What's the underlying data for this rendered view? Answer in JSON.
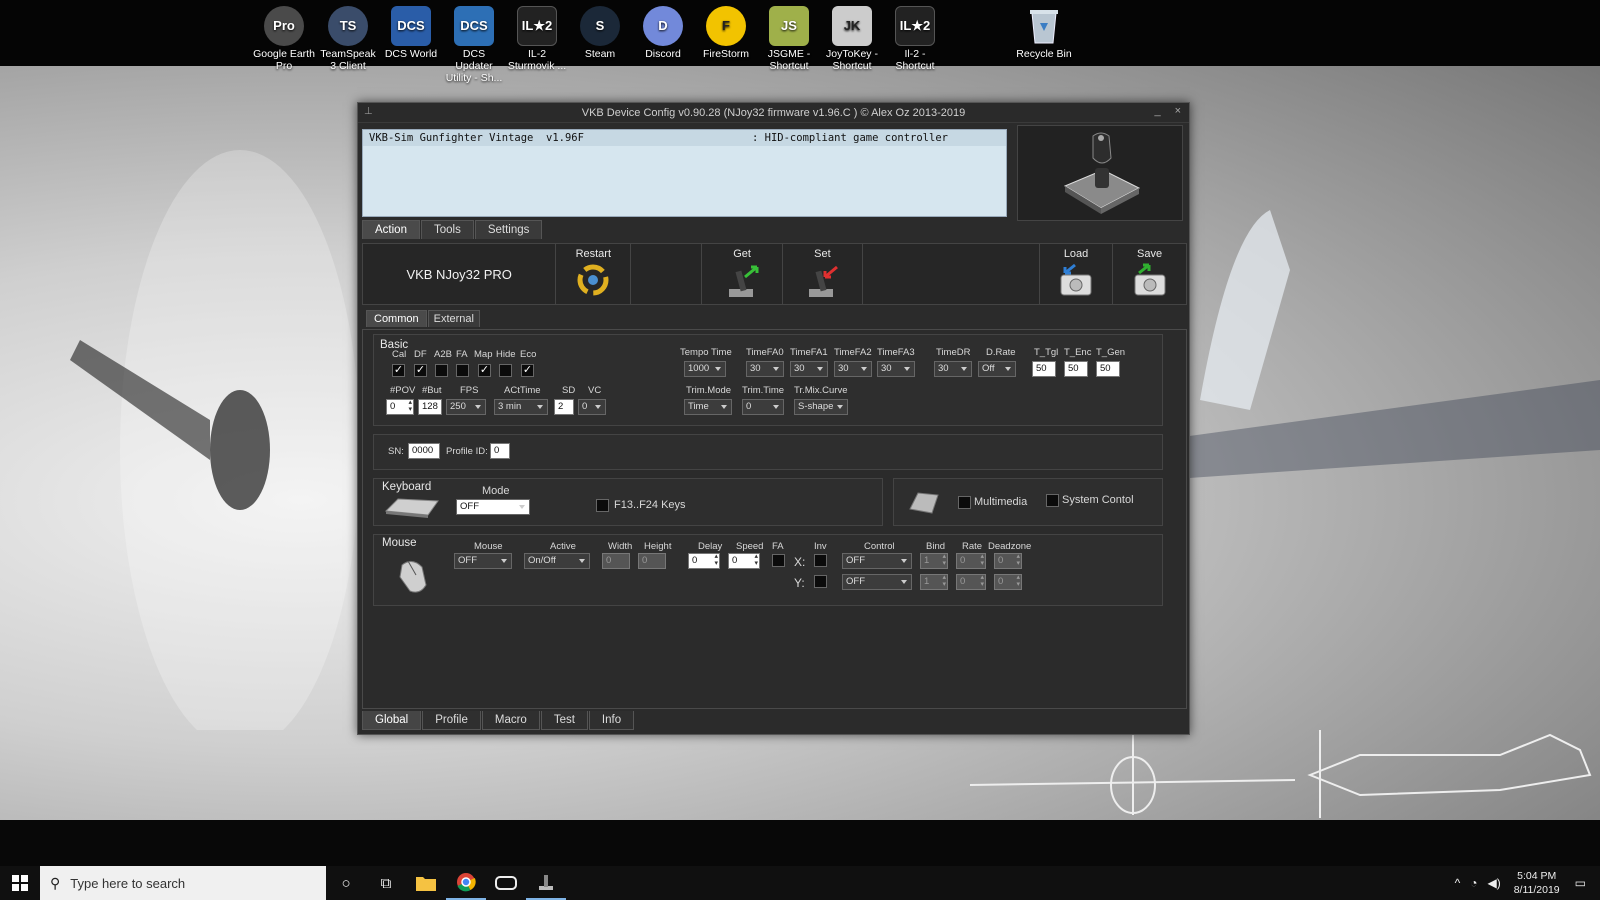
{
  "desktop": {
    "icons": [
      {
        "label": "Google Earth Pro",
        "color": "#4a4a4a",
        "glyph": "Pro"
      },
      {
        "label": "TeamSpeak 3 Client",
        "color": "#3a4c6a",
        "glyph": "TS"
      },
      {
        "label": "DCS World",
        "color": "#2a5da8",
        "glyph": "DCS"
      },
      {
        "label": "DCS Updater Utility - Sh...",
        "color": "#2d6fb5",
        "glyph": "DCS"
      },
      {
        "label": "IL-2 Sturmovik ...",
        "color": "#222222",
        "glyph": "IL★2"
      },
      {
        "label": "Steam",
        "color": "#1b2838",
        "glyph": "S"
      },
      {
        "label": "Discord",
        "color": "#7289da",
        "glyph": "D"
      },
      {
        "label": "FireStorm",
        "color": "#f2c300",
        "glyph": "F"
      },
      {
        "label": "JSGME - Shortcut",
        "color": "#9fb04a",
        "glyph": "JS"
      },
      {
        "label": "JoyToKey - Shortcut",
        "color": "#cccccc",
        "glyph": "JK"
      },
      {
        "label": "Il-2 - Shortcut",
        "color": "#222222",
        "glyph": "IL★2"
      }
    ],
    "recycle_bin": "Recycle Bin"
  },
  "window": {
    "title": "VKB Device Config v0.90.28 (NJoy32 firmware v1.96.C  ) © Alex Oz 2013-2019",
    "minimize": "_",
    "close": "×",
    "device_list": {
      "name": "VKB-Sim Gunfighter Vintage  v1.96F",
      "type": ": HID-compliant game controller"
    },
    "top_tabs": [
      "Action",
      "Tools",
      "Settings"
    ],
    "action": {
      "device_title": "VKB NJoy32 PRO",
      "restart": "Restart",
      "get": "Get",
      "set": "Set",
      "load": "Load",
      "save": "Save"
    },
    "sub_tabs": [
      "Common",
      "External"
    ],
    "basic": {
      "title": "Basic",
      "flags": [
        {
          "label": "Cal",
          "checked": true
        },
        {
          "label": "DF",
          "checked": true
        },
        {
          "label": "A2B",
          "checked": false
        },
        {
          "label": "FA",
          "checked": false
        },
        {
          "label": "Map",
          "checked": true
        },
        {
          "label": "Hide",
          "checked": false
        },
        {
          "label": "Eco",
          "checked": true
        }
      ],
      "pov_label": "#POV",
      "pov_value": "0",
      "but_label": "#But",
      "but_value": "128",
      "fps_label": "FPS",
      "fps_value": "250",
      "actime_label": "ACtTime",
      "actime_value": "3 min",
      "sd_label": "SD",
      "sd_value": "2",
      "vc_label": "VC",
      "vc_value": "0",
      "tempo_label": "Tempo Time",
      "tempo_value": "1000",
      "timefa": [
        {
          "label": "TimeFA0",
          "value": "30"
        },
        {
          "label": "TimeFA1",
          "value": "30"
        },
        {
          "label": "TimeFA2",
          "value": "30"
        },
        {
          "label": "TimeFA3",
          "value": "30"
        }
      ],
      "timedr_label": "TimeDR",
      "timedr_value": "30",
      "drate_label": "D.Rate",
      "drate_value": "Off",
      "t_tgl_label": "T_Tgl",
      "t_tgl_value": "50",
      "t_enc_label": "T_Enc",
      "t_enc_value": "50",
      "t_gen_label": "T_Gen",
      "t_gen_value": "50",
      "trim_mode_label": "Trim.Mode",
      "trim_mode_value": "Time",
      "trim_time_label": "Trim.Time",
      "trim_time_value": "0",
      "mix_curve_label": "Tr.Mix.Curve",
      "mix_curve_value": "S-shape"
    },
    "serial": {
      "sn_label": "SN:",
      "sn_value": "0000",
      "profile_label": "Profile ID:",
      "profile_value": "0"
    },
    "keyboard": {
      "title": "Keyboard",
      "mode_label": "Mode",
      "mode_value": "OFF",
      "f13_label": "F13..F24 Keys",
      "multimedia_label": "Multimedia",
      "system_label": "System Contol"
    },
    "mouse": {
      "title": "Mouse",
      "mouse_label": "Mouse",
      "mouse_value": "OFF",
      "active_label": "Active",
      "active_value": "On/Off",
      "width_label": "Width",
      "width_value": "0",
      "height_label": "Height",
      "height_value": "0",
      "delay_label": "Delay",
      "delay_value": "0",
      "speed_label": "Speed",
      "speed_value": "0",
      "fa_label": "FA",
      "inv_label": "Inv",
      "x_label": "X:",
      "y_label": "Y:",
      "control_label": "Control",
      "control_x": "OFF",
      "control_y": "OFF",
      "bind_label": "Bind",
      "bind_x": "1",
      "bind_y": "1",
      "rate_label": "Rate",
      "rate_x": "0",
      "rate_y": "0",
      "deadzone_label": "Deadzone",
      "deadzone_x": "0",
      "deadzone_y": "0"
    },
    "bottom_tabs": [
      "Global",
      "Profile",
      "Macro",
      "Test",
      "Info"
    ]
  },
  "taskbar": {
    "search_placeholder": "Type here to search",
    "time": "5:04 PM",
    "date": "8/11/2019"
  }
}
